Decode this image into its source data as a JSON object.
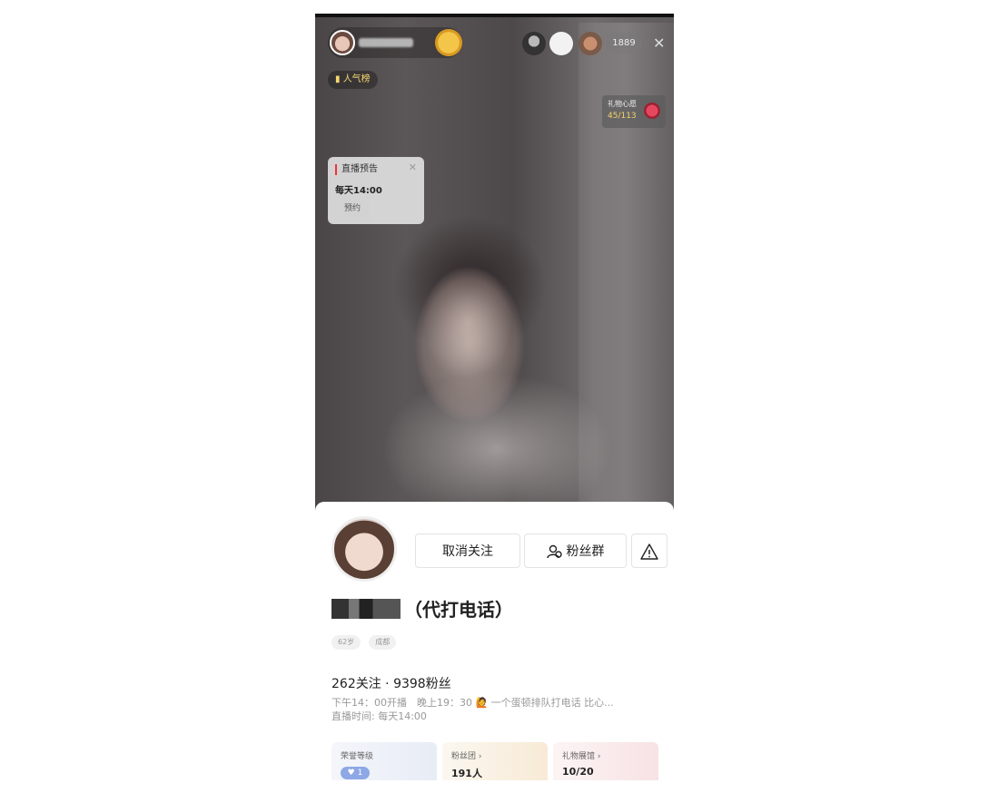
{
  "live": {
    "rank_tag": "人气榜",
    "viewer_count": "1889",
    "close_symbol": "✕",
    "gift_goal": {
      "label": "礼物心愿",
      "count": "45/113"
    },
    "preview_card": {
      "title": "直播预告",
      "time": "每天14:00",
      "button": "预约",
      "close_symbol": "✕"
    }
  },
  "profile": {
    "unfollow_label": "取消关注",
    "fan_group_label": "粉丝群",
    "report_icon": "warning-icon",
    "name_suffix": "（代打电话）",
    "chips": [
      "62岁",
      "成都"
    ],
    "stats": "262关注 · 9398粉丝",
    "bio_line1": "下午14：00开播　晚上19：30 🙋 一个蛋顿排队打电话 比心...",
    "bio_line2": "直播时间: 每天14:00",
    "cards": {
      "honor": {
        "label": "荣誉等级",
        "badge": "♥ 1"
      },
      "fans": {
        "label": "粉丝团 ›",
        "value": "191人"
      },
      "gift": {
        "label": "礼物展馆 ›",
        "value": "10/20"
      }
    }
  }
}
